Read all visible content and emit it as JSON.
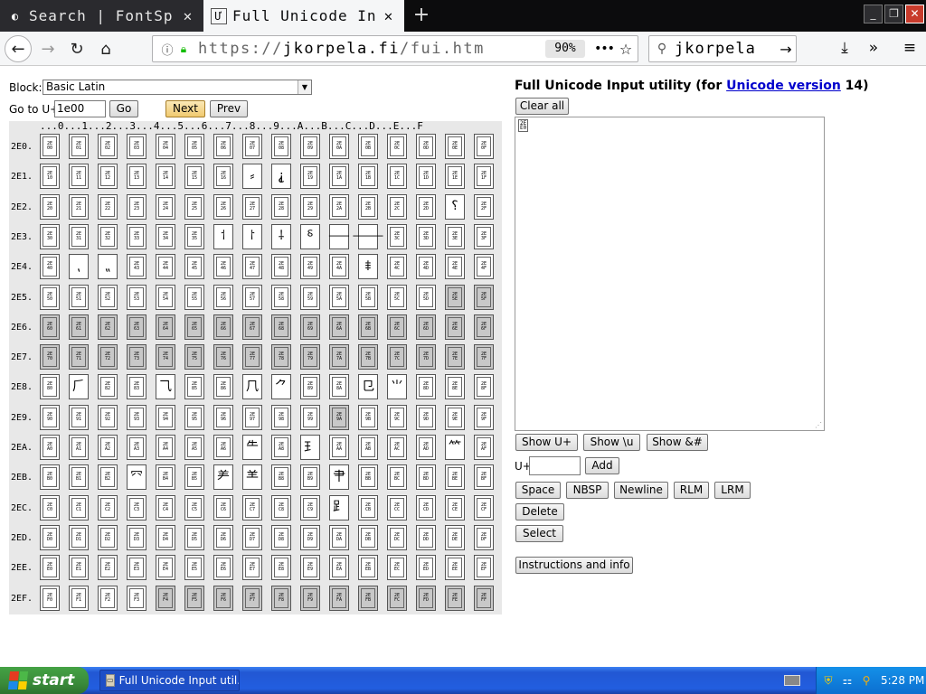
{
  "browser": {
    "tabs": [
      {
        "label": "Search | FontSp",
        "active": false,
        "icon": "fontspace-icon"
      },
      {
        "label": "Full Unicode In",
        "active": true,
        "icon": "unicode-icon"
      }
    ],
    "url_prefix": "https://",
    "url_domain": "jkorpela.fi",
    "url_path": "/fui.htm",
    "zoom": "90%",
    "search_text": "jkorpela"
  },
  "page": {
    "block_label": "Block:",
    "block_value": "Basic Latin",
    "goto_label": "Go to U+",
    "goto_value": "1e00",
    "go_button": "Go",
    "next_button": "Next",
    "prev_button": "Prev",
    "title_prefix": "Full Unicode Input utility (for ",
    "title_link": "Unicode version",
    "title_suffix": " 14)",
    "clear_all": "Clear all",
    "textarea_value": "2E\nE0",
    "show_u": "Show U+",
    "show_backslash_u": "Show \\u",
    "show_amp": "Show &#",
    "u_label": "U+",
    "add_button": "Add",
    "space_button": "Space",
    "nbsp_button": "NBSP",
    "newline_button": "Newline",
    "rlm_button": "RLM",
    "lrm_button": "LRM",
    "delete_button": "Delete",
    "select_button": "Select",
    "instructions_button": "Instructions and info"
  },
  "grid": {
    "column_header": "...0...1...2...3...4...5...6...7...8...9...A...B...C...D...E...F",
    "rows": [
      {
        "label": "2E0.",
        "codes": [
          "2E\n00",
          "2E\n01",
          "2E\n02",
          "2E\n03",
          "2E\n04",
          "2E\n05",
          "2E\n06",
          "2E\n07",
          "2E\n08",
          "2E\n09",
          "2E\n0A",
          "2E\n0B",
          "2E\n0C",
          "2E\n0D",
          "2E\n0E",
          "2E\n0F"
        ]
      },
      {
        "label": "2E1.",
        "codes": [
          "2E\n10",
          "2E\n11",
          "2E\n12",
          "2E\n13",
          "2E\n14",
          "2E\n15",
          "2E\n16",
          "⸗",
          "⸘",
          "2E\n19",
          "2E\n1A",
          "2E\n1B",
          "2E\n1C",
          "2E\n1D",
          "2E\n1E",
          "2E\n1F"
        ]
      },
      {
        "label": "2E2.",
        "codes": [
          "2E\n20",
          "2E\n21",
          "2E\n22",
          "2E\n23",
          "2E\n24",
          "2E\n25",
          "2E\n26",
          "2E\n27",
          "2E\n28",
          "2E\n29",
          "2E\n2A",
          "2E\n2B",
          "2E\n2C",
          "2E\n2D",
          "⸮",
          "2E\n2F"
        ]
      },
      {
        "label": "2E3.",
        "codes": [
          "2E\n30",
          "2E\n31",
          "2E\n32",
          "2E\n33",
          "2E\n34",
          "2E\n35",
          "⸶",
          "⸷",
          "⸸",
          "⸹",
          "⸺",
          "⸻",
          "2E\n3C",
          "2E\n3D",
          "2E\n3E",
          "2E\n3F"
        ]
      },
      {
        "label": "2E4.",
        "codes": [
          "2E\n40",
          "⹁",
          "⹂",
          "2E\n43",
          "2E\n44",
          "2E\n45",
          "2E\n46",
          "2E\n47",
          "2E\n48",
          "2E\n49",
          "2E\n4A",
          "⹋",
          "2E\n4C",
          "2E\n4D",
          "2E\n4E",
          "2E\n4F"
        ]
      },
      {
        "label": "2E5.",
        "codes": [
          "2E\n50",
          "2E\n51",
          "2E\n52",
          "2E\n53",
          "2E\n54",
          "2E\n55",
          "2E\n56",
          "2E\n57",
          "2E\n58",
          "2E\n59",
          "2E\n5A",
          "2E\n5B",
          "2E\n5C",
          "2E\n5D",
          "2E\n5E",
          "2E\n5F"
        ]
      },
      {
        "label": "2E6.",
        "codes": [
          "2E\n60",
          "2E\n61",
          "2E\n62",
          "2E\n63",
          "2E\n64",
          "2E\n65",
          "2E\n66",
          "2E\n67",
          "2E\n68",
          "2E\n69",
          "2E\n6A",
          "2E\n6B",
          "2E\n6C",
          "2E\n6D",
          "2E\n6E",
          "2E\n6F"
        ]
      },
      {
        "label": "2E7.",
        "codes": [
          "2E\n70",
          "2E\n71",
          "2E\n72",
          "2E\n73",
          "2E\n74",
          "2E\n75",
          "2E\n76",
          "2E\n77",
          "2E\n78",
          "2E\n79",
          "2E\n7A",
          "2E\n7B",
          "2E\n7C",
          "2E\n7D",
          "2E\n7E",
          "2E\n7F"
        ]
      },
      {
        "label": "2E8.",
        "codes": [
          "2E\n80",
          "⺁",
          "2E\n82",
          "2E\n83",
          "⺄",
          "2E\n85",
          "2E\n86",
          "⺇",
          "⺈",
          "2E\n89",
          "2E\n8A",
          "⺋",
          "⺌",
          "2E\n8D",
          "2E\n8E",
          "2E\n8F"
        ]
      },
      {
        "label": "2E9.",
        "codes": [
          "2E\n90",
          "2E\n91",
          "2E\n92",
          "2E\n93",
          "2E\n94",
          "2E\n95",
          "2E\n96",
          "2E\n97",
          "2E\n98",
          "2E\n99",
          "2E\n9A",
          "2E\n9B",
          "2E\n9C",
          "2E\n9D",
          "2E\n9E",
          "2E\n9F"
        ]
      },
      {
        "label": "2EA.",
        "codes": [
          "2E\nA0",
          "2E\nA1",
          "2E\nA2",
          "2E\nA3",
          "2E\nA4",
          "2E\nA5",
          "2E\nA6",
          "⺧",
          "2E\nA8",
          "⺩",
          "2E\nAA",
          "2E\nAB",
          "2E\nAC",
          "2E\nAD",
          "⺮",
          "2E\nAF"
        ]
      },
      {
        "label": "2EB.",
        "codes": [
          "2E\nB0",
          "2E\nB1",
          "2E\nB2",
          "⺳",
          "2E\nB4",
          "2E\nB5",
          "⺶",
          "⺷",
          "2E\nB8",
          "2E\nB9",
          "⺺",
          "2E\nBB",
          "2E\nBC",
          "2E\nBD",
          "2E\nBE",
          "2E\nBF"
        ]
      },
      {
        "label": "2EC.",
        "codes": [
          "2E\nC0",
          "2E\nC1",
          "2E\nC2",
          "2E\nC3",
          "2E\nC4",
          "2E\nC5",
          "2E\nC6",
          "2E\nC7",
          "2E\nC8",
          "2E\nC9",
          "⻊",
          "2E\nCB",
          "2E\nCC",
          "2E\nCD",
          "2E\nCE",
          "2E\nCF"
        ]
      },
      {
        "label": "2ED.",
        "codes": [
          "2E\nD0",
          "2E\nD1",
          "2E\nD2",
          "2E\nD3",
          "2E\nD4",
          "2E\nD5",
          "2E\nD6",
          "2E\nD7",
          "2E\nD8",
          "2E\nD9",
          "2E\nDA",
          "2E\nDB",
          "2E\nDC",
          "2E\nDD",
          "2E\nDE",
          "2E\nDF"
        ]
      },
      {
        "label": "2EE.",
        "codes": [
          "2E\nE0",
          "2E\nE1",
          "2E\nE2",
          "2E\nE3",
          "2E\nE4",
          "2E\nE5",
          "2E\nE6",
          "2E\nE7",
          "2E\nE8",
          "2E\nE9",
          "2E\nEA",
          "2E\nEB",
          "2E\nEC",
          "2E\nED",
          "2E\nEE",
          "2E\nEF"
        ]
      },
      {
        "label": "2EF.",
        "codes": [
          "2E\nF0",
          "2E\nF1",
          "2E\nF2",
          "2E\nF3",
          "2E\nF4",
          "2E\nF5",
          "2E\nF6",
          "2E\nF7",
          "2E\nF8",
          "2E\nF9",
          "2E\nFA",
          "2E\nFB",
          "2E\nFC",
          "2E\nFD",
          "2E\nFE",
          "2E\nFF"
        ]
      }
    ],
    "reserved": {
      "2E5.": [
        14,
        15
      ],
      "2E6.": [
        0,
        1,
        2,
        3,
        4,
        5,
        6,
        7,
        8,
        9,
        10,
        11,
        12,
        13,
        14,
        15
      ],
      "2E7.": [
        0,
        1,
        2,
        3,
        4,
        5,
        6,
        7,
        8,
        9,
        10,
        11,
        12,
        13,
        14,
        15
      ],
      "2E9.": [
        10
      ],
      "2EF.": [
        4,
        5,
        6,
        7,
        8,
        9,
        10,
        11,
        12,
        13,
        14,
        15
      ]
    }
  },
  "taskbar": {
    "start_label": "start",
    "task_label": "Full Unicode Input util...",
    "clock": "5:28 PM"
  }
}
